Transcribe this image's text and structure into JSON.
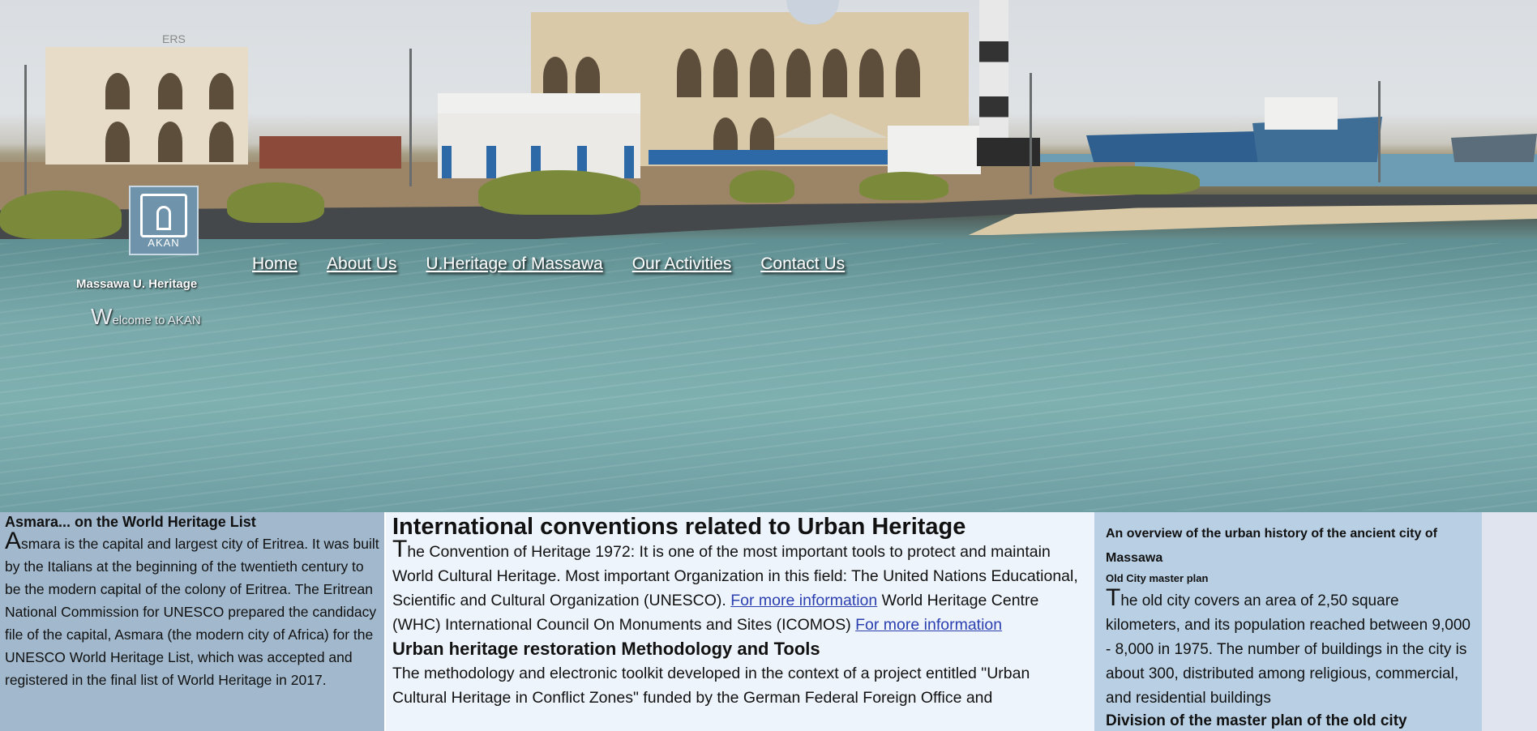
{
  "header": {
    "logo_text": "AKAN",
    "site_name": "Massawa U. Heritage",
    "welcome_initial": "W",
    "welcome_rest": "elcome to AKAN"
  },
  "nav": {
    "items": [
      {
        "label": "Home"
      },
      {
        "label": "About Us"
      },
      {
        "label": "U.Heritage of Massawa"
      },
      {
        "label": "Our Activities"
      },
      {
        "label": "Contact Us"
      }
    ]
  },
  "left_column": {
    "title": "Asmara... on the World Heritage List",
    "initial": "A",
    "body": "smara is the capital and largest city of Eritrea. It was built by the Italians at the beginning of the twentieth century to be the modern capital of the colony of Eritrea. The Eritrean National Commission for UNESCO prepared the candidacy file of the capital, Asmara (the modern city of Africa) for the UNESCO World Heritage List, which was accepted and registered in the final list of World Heritage in 2017."
  },
  "middle_column": {
    "title": "International conventions related to Urban Heritage",
    "initial": "T",
    "body_part1": "he Convention of Heritage 1972: It is one of the most important tools to protect and maintain World Cultural Heritage. Most important Organization in this field: The United Nations Educational, Scientific and Cultural Organization (UNESCO).",
    "link1": "For more information",
    "body_part2": "World Heritage Centre (WHC) International Council On Monuments and Sites (ICOMOS)",
    "link2": "For more information",
    "section2_title": "Urban heritage restoration Methodology and Tools",
    "section2_body": "The methodology and electronic toolkit developed in the context of a project entitled \"Urban Cultural Heritage in Conflict Zones\" funded by the German Federal Foreign Office and"
  },
  "right_column": {
    "title": "An overview of the urban history of the ancient city of Massawa",
    "subtitle": "Old City master plan",
    "initial": "T",
    "body": "he old city covers an area of 2,50 square kilometers, and its population reached between 9,000 - 8,000 in 1975. The number of buildings in the city is about 300, distributed among religious, commercial, and residential buildings",
    "section2_title": "Division of the master plan of the old city"
  },
  "banner_sign": "ERS"
}
